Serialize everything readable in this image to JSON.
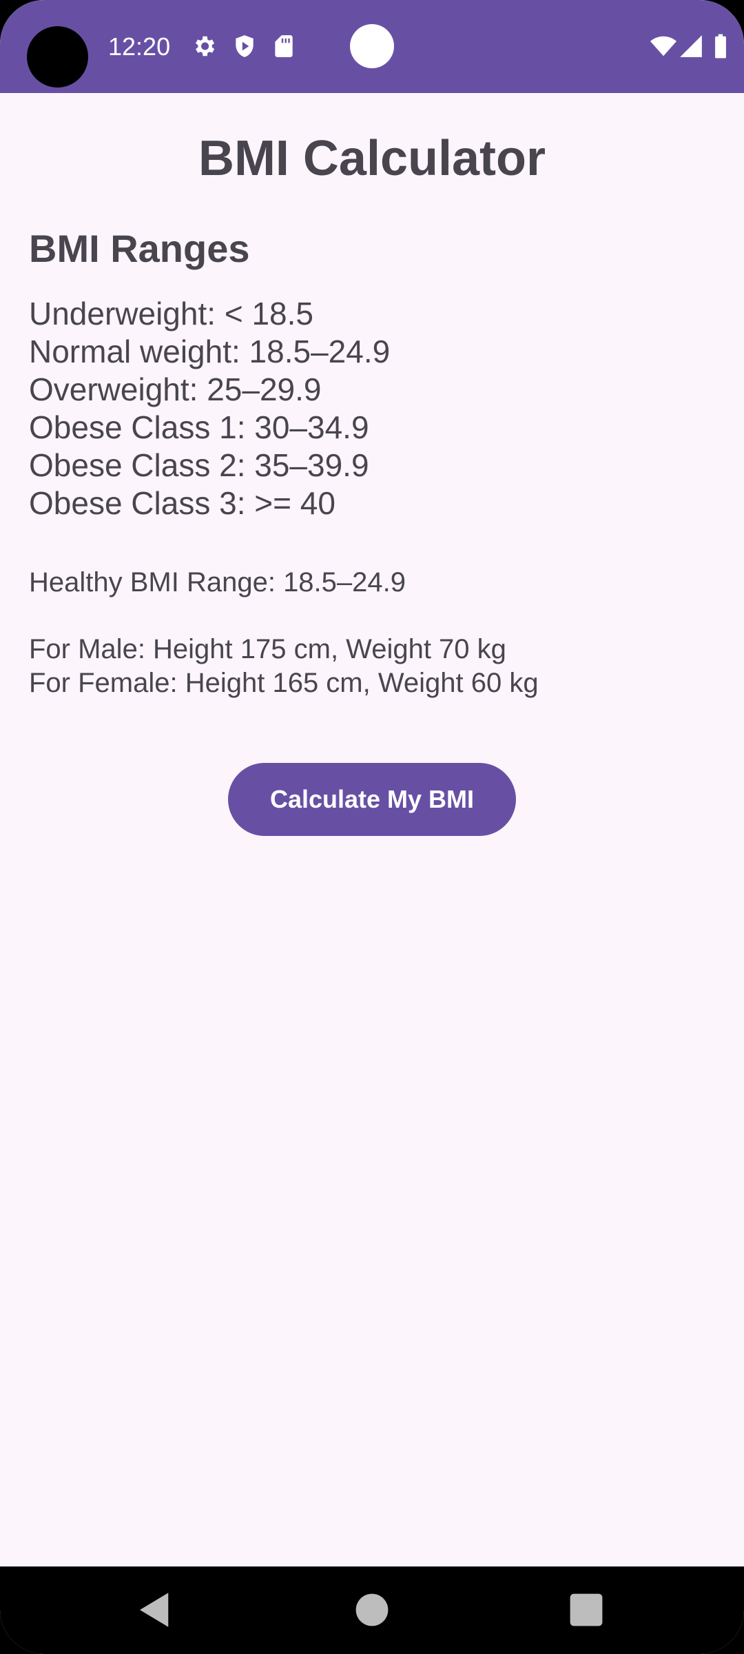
{
  "status_bar": {
    "time": "12:20",
    "left_icons": [
      "gear-icon",
      "shield-play-icon",
      "sd-card-icon"
    ],
    "right_icons": [
      "wifi-icon",
      "signal-icon",
      "battery-icon"
    ],
    "color": "#6750A4"
  },
  "app": {
    "title": "BMI Calculator"
  },
  "ranges_section": {
    "title": "BMI Ranges",
    "items": [
      "Underweight: < 18.5",
      "Normal weight: 18.5–24.9",
      "Overweight: 25–29.9",
      "Obese Class 1: 30–34.9",
      "Obese Class 2: 35–39.9",
      "Obese Class 3: >= 40"
    ]
  },
  "healthy_range": "Healthy BMI Range: 18.5–24.9",
  "ideal": {
    "male": "For Male: Height 175 cm, Weight 70 kg",
    "female": "For Female: Height 165 cm, Weight 60 kg"
  },
  "button": {
    "label": "Calculate My BMI",
    "color": "#6750A4"
  },
  "nav_bar": {
    "buttons": [
      "back-icon",
      "home-icon",
      "recents-icon"
    ]
  }
}
